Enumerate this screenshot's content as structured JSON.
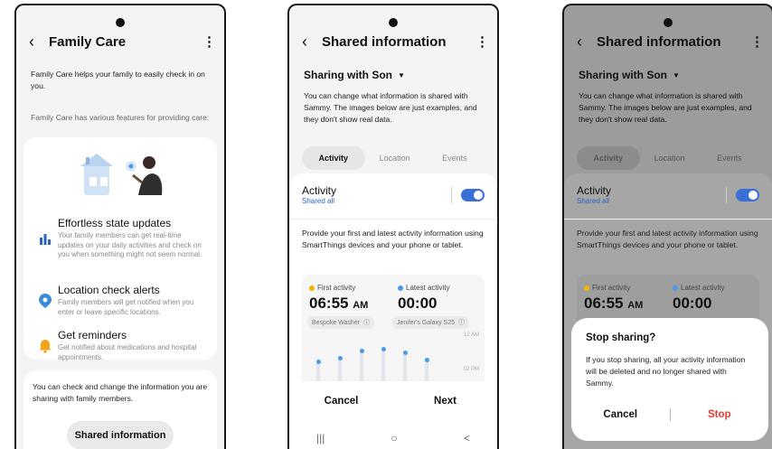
{
  "phone1": {
    "title": "Family Care",
    "intro": "Family Care helps your family to easily check in on you.",
    "features_intro": "Family Care has various features for providing care:",
    "features": [
      {
        "icon": "bar-chart-icon",
        "title": "Effortless state updates",
        "desc": "Your family members can get real-time updates on your daily activities and check on you when something might not seem normal."
      },
      {
        "icon": "location-pin-icon",
        "title": "Location check alerts",
        "desc": "Family members will get notified when you enter or leave specific locations."
      },
      {
        "icon": "bell-icon",
        "title": "Get reminders",
        "desc": "Get notified about medications and hospital appointments."
      }
    ],
    "check_text": "You can check and change the information you are sharing with family members.",
    "shared_button": "Shared information"
  },
  "phone2": {
    "title": "Shared information",
    "sharing_with": "Sharing with Son",
    "desc": "You can change what information is shared with Sammy. The images below are just examples, and they don't show real data.",
    "tabs": [
      "Activity",
      "Location",
      "Events"
    ],
    "activity_label": "Activity",
    "activity_sub": "Shared all",
    "activity_desc": "Provide your first and latest activity information using SmartThings devices and your phone or tablet.",
    "first_activity_label": "First activity",
    "first_activity_time": "06:55",
    "first_activity_ampm": "AM",
    "latest_activity_label": "Latest activity",
    "latest_activity_time": "00:00",
    "device1": "Bespoke Washer",
    "device2": "Jenifer's Galaxy S25",
    "tick1": "12 AM",
    "tick2": "02 PM",
    "cancel": "Cancel",
    "next": "Next",
    "nav": [
      "|||",
      "○",
      "<"
    ]
  },
  "phone3": {
    "title": "Shared information",
    "sharing_with": "Sharing with Son",
    "desc": "You can change what information is shared with Sammy. The images below are just examples, and they don't show real data.",
    "tabs": [
      "Activity",
      "Location",
      "Events"
    ],
    "activity_label": "Activity",
    "activity_sub": "Shared all",
    "activity_desc": "Provide your first and latest activity information using SmartThings devices and your phone or tablet.",
    "first_activity_label": "First activity",
    "first_activity_time": "06:55",
    "first_activity_ampm": "AM",
    "latest_activity_label": "Latest activity",
    "latest_activity_time": "00:00",
    "dialog": {
      "title": "Stop sharing?",
      "desc": "If you stop sharing, all your activity information will be deleted and no longer shared with Sammy.",
      "cancel": "Cancel",
      "stop": "Stop"
    }
  },
  "colors": {
    "toggle": "#3b6fd8",
    "stop": "#e53935",
    "accent_blue": "#2c64c6"
  }
}
